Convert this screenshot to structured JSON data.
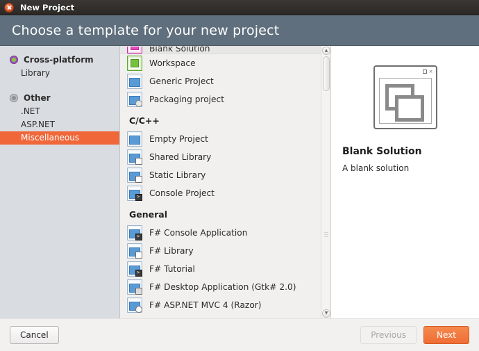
{
  "titlebar": {
    "title": "New Project",
    "close_icon": "close-icon"
  },
  "header": {
    "title": "Choose a template for your new project"
  },
  "sidebar": {
    "groups": [
      {
        "label": "Cross-platform",
        "icon": "cross-platform-circle-icon",
        "children": [
          {
            "label": "Library",
            "selected": false
          }
        ]
      },
      {
        "label": "Other",
        "icon": "other-circle-icon",
        "children": [
          {
            "label": ".NET",
            "selected": false
          },
          {
            "label": "ASP.NET",
            "selected": false
          },
          {
            "label": "Miscellaneous",
            "selected": true
          }
        ]
      }
    ]
  },
  "template_list": {
    "rows": [
      {
        "label": "Blank Solution",
        "icon": "blank-solution-icon",
        "selected": true,
        "clipped": true
      },
      {
        "label": "Workspace",
        "icon": "workspace-icon",
        "selected": false
      },
      {
        "label": "Generic Project",
        "icon": "generic-project-icon",
        "selected": false
      },
      {
        "label": "Packaging project",
        "icon": "packaging-project-icon",
        "selected": false
      }
    ],
    "section_cpp": "C/C++",
    "rows_cpp": [
      {
        "label": "Empty Project",
        "icon": "empty-project-icon"
      },
      {
        "label": "Shared Library",
        "icon": "shared-library-icon"
      },
      {
        "label": "Static Library",
        "icon": "static-library-icon"
      },
      {
        "label": "Console Project",
        "icon": "console-project-icon"
      }
    ],
    "section_general": "General",
    "rows_general": [
      {
        "label": "F# Console Application",
        "icon": "fsharp-console-icon"
      },
      {
        "label": "F# Library",
        "icon": "fsharp-library-icon"
      },
      {
        "label": "F# Tutorial",
        "icon": "fsharp-tutorial-icon"
      },
      {
        "label": "F# Desktop Application (Gtk# 2.0)",
        "icon": "fsharp-desktop-icon"
      },
      {
        "label": "F# ASP.NET MVC 4 (Razor)",
        "icon": "fsharp-aspnet-icon"
      }
    ]
  },
  "preview": {
    "title": "Blank Solution",
    "description": "A blank solution",
    "art_close": "×"
  },
  "footer": {
    "cancel": "Cancel",
    "previous": "Previous",
    "next": "Next"
  },
  "colors": {
    "header_bg": "#5f6f7d",
    "selection_orange": "#f0673a",
    "primary_button": "#ef6d35",
    "sidebar_bg": "#d9dde1",
    "titlebar_bg": "#2c2825"
  }
}
